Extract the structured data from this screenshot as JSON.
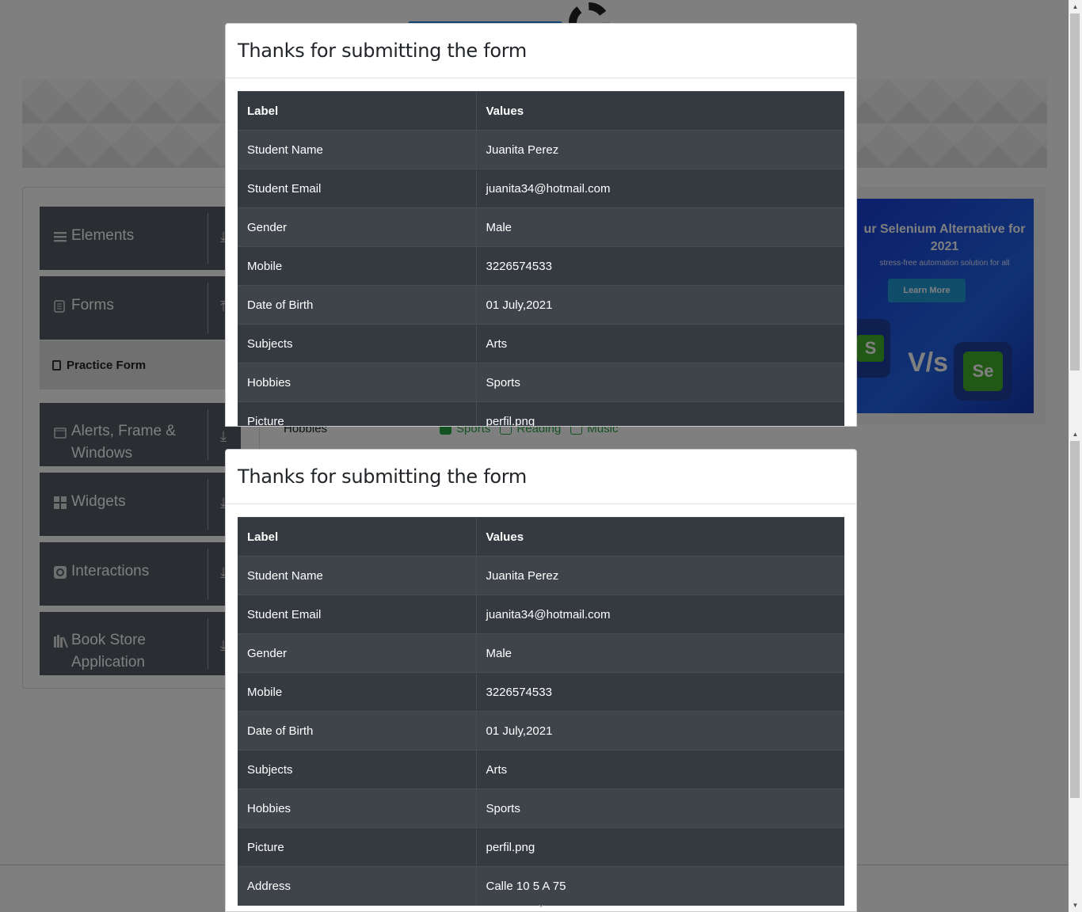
{
  "sidebar": {
    "groups": [
      {
        "label": "Elements",
        "icon": "list-icon"
      },
      {
        "label": "Forms",
        "icon": "document-icon"
      },
      {
        "label": "Alerts, Frame & Windows",
        "icon": "window-icon"
      },
      {
        "label": "Widgets",
        "icon": "widgets-icon"
      },
      {
        "label": "Interactions",
        "icon": "interactions-icon"
      },
      {
        "label": "Book Store Application",
        "icon": "books-icon"
      }
    ],
    "active_item": "Practice Form"
  },
  "form_behind": {
    "hobbies_label": "Hobbies",
    "options": [
      {
        "label": "Sports",
        "checked": true
      },
      {
        "label": "Reading",
        "checked": false
      },
      {
        "label": "Music",
        "checked": false
      }
    ]
  },
  "ad": {
    "headline": "ur Selenium Alternative for 2021",
    "subline": "stress-free automation solution for all",
    "button": "Learn More",
    "vs": "V/s",
    "se": "Se",
    "s": "S"
  },
  "modal": {
    "title": "Thanks for submitting the form",
    "header_label": "Label",
    "header_values": "Values",
    "rows": [
      {
        "label": "Student Name",
        "value": "Juanita Perez"
      },
      {
        "label": "Student Email",
        "value": "juanita34@hotmail.com"
      },
      {
        "label": "Gender",
        "value": "Male"
      },
      {
        "label": "Mobile",
        "value": "3226574533"
      },
      {
        "label": "Date of Birth",
        "value": "01 July,2021"
      },
      {
        "label": "Subjects",
        "value": "Arts"
      },
      {
        "label": "Hobbies",
        "value": "Sports"
      },
      {
        "label": "Picture",
        "value": "perfil.png"
      },
      {
        "label": "Address",
        "value": "Calle 10 5 A 75"
      }
    ]
  },
  "colors": {
    "backdrop": "#000000",
    "table_dark": "#343a40",
    "table_stripe": "#3e444a",
    "sidebar_group": "#545b62",
    "success": "#28a745",
    "ad_blue": "#2163e8"
  }
}
